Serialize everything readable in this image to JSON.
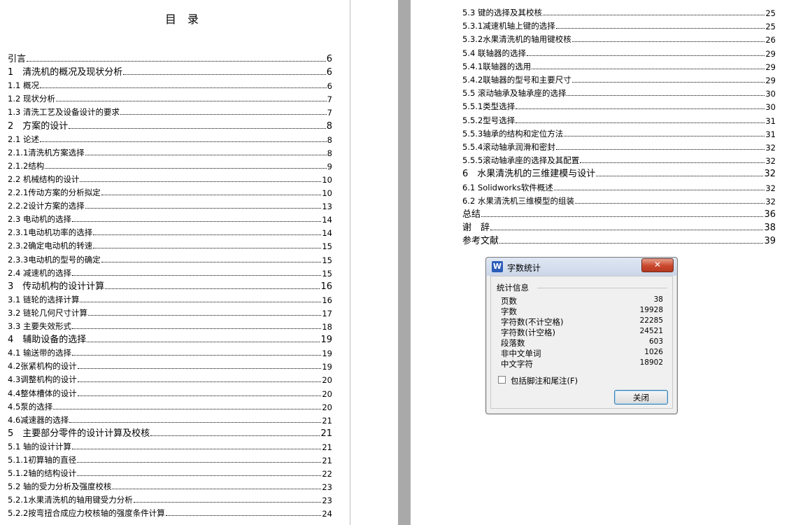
{
  "left_page": {
    "title": "目　录",
    "entries": [
      {
        "text": "引言",
        "page": "6",
        "level": 0
      },
      {
        "text": "1　清洗机的概况及现状分析",
        "page": "6",
        "level": 0
      },
      {
        "text": "1.1 概况",
        "page": "6",
        "level": 1
      },
      {
        "text": "1.2 现状分析",
        "page": "7",
        "level": 1
      },
      {
        "text": "1.3 清洗工艺及设备设计的要求",
        "page": "7",
        "level": 1
      },
      {
        "text": "2　方案的设计",
        "page": "8",
        "level": 0
      },
      {
        "text": "2.1 论述",
        "page": "8",
        "level": 1
      },
      {
        "text": "2.1.1清洗机方案选择",
        "page": "8",
        "level": 1
      },
      {
        "text": "2.1.2结构",
        "page": "9",
        "level": 1
      },
      {
        "text": "2.2 机械结构的设计",
        "page": "10",
        "level": 1
      },
      {
        "text": "2.2.1传动方案的分析拟定",
        "page": "10",
        "level": 1
      },
      {
        "text": "2.2.2设计方案的选择",
        "page": "13",
        "level": 1
      },
      {
        "text": "2.3 电动机的选择",
        "page": "14",
        "level": 1
      },
      {
        "text": "2.3.1电动机功率的选择",
        "page": "14",
        "level": 1
      },
      {
        "text": "2.3.2确定电动机的转速",
        "page": "15",
        "level": 1
      },
      {
        "text": "2.3.3电动机的型号的确定",
        "page": "15",
        "level": 1
      },
      {
        "text": "2.4 减速机的选择",
        "page": "15",
        "level": 1
      },
      {
        "text": "3　传动机构的设计计算",
        "page": "16",
        "level": 0
      },
      {
        "text": "3.1 链轮的选择计算",
        "page": "16",
        "level": 1
      },
      {
        "text": "3.2 链轮几何尺寸计算",
        "page": "17",
        "level": 1
      },
      {
        "text": "3.3 主要失效形式",
        "page": "18",
        "level": 1
      },
      {
        "text": "4　辅助设备的选择",
        "page": "19",
        "level": 0
      },
      {
        "text": "4.1 输送带的选择",
        "page": "19",
        "level": 1
      },
      {
        "text": "4.2张紧机构的设计",
        "page": "19",
        "level": 1
      },
      {
        "text": "4.3调整机构的设计",
        "page": "20",
        "level": 1
      },
      {
        "text": "4.4整体槽体的设计",
        "page": "20",
        "level": 1
      },
      {
        "text": "4.5泵的选择",
        "page": "20",
        "level": 1
      },
      {
        "text": "4.6减速器的选择",
        "page": "21",
        "level": 1
      },
      {
        "text": "5　主要部分零件的设计计算及校核",
        "page": "21",
        "level": 0
      },
      {
        "text": "5.1 轴的设计计算",
        "page": "21",
        "level": 1
      },
      {
        "text": "5.1.1初算轴的直径",
        "page": "21",
        "level": 1
      },
      {
        "text": "5.1.2轴的结构设计",
        "page": "22",
        "level": 1
      },
      {
        "text": "5.2 轴的受力分析及强度校核",
        "page": "23",
        "level": 1
      },
      {
        "text": "5.2.1水果清洗机的轴用键受力分析",
        "page": "23",
        "level": 1
      },
      {
        "text": "5.2.2按弯扭合成应力校核轴的强度条件计算",
        "page": "24",
        "level": 1
      }
    ]
  },
  "right_page": {
    "entries": [
      {
        "text": "5.3 键的选择及其校核",
        "page": "25",
        "level": 1
      },
      {
        "text": "5.3.1减速机轴上键的选择",
        "page": "25",
        "level": 1
      },
      {
        "text": "5.3.2水果清洗机的轴用键校核",
        "page": "26",
        "level": 1
      },
      {
        "text": "5.4 联轴器的选择",
        "page": "29",
        "level": 1
      },
      {
        "text": "5.4.1联轴器的选用",
        "page": "29",
        "level": 1
      },
      {
        "text": "5.4.2联轴器的型号和主要尺寸",
        "page": "29",
        "level": 1
      },
      {
        "text": "5.5 滚动轴承及轴承座的选择",
        "page": "30",
        "level": 1
      },
      {
        "text": "5.5.1类型选择",
        "page": "30",
        "level": 1
      },
      {
        "text": "5.5.2型号选择",
        "page": "31",
        "level": 1
      },
      {
        "text": "5.5.3轴承的结构和定位方法",
        "page": "31",
        "level": 1
      },
      {
        "text": "5.5.4滚动轴承润滑和密封",
        "page": "32",
        "level": 1
      },
      {
        "text": "5.5.5滚动轴承座的选择及其配置",
        "page": "32",
        "level": 1
      },
      {
        "text": "6　水果清洗机的三维建模与设计",
        "page": "32",
        "level": 0
      },
      {
        "text": "6.1 Solidworks软件概述",
        "page": "32",
        "level": 1
      },
      {
        "text": "6.2 水果清洗机三维模型的组装",
        "page": "32",
        "level": 1
      },
      {
        "text": "总结",
        "page": "36",
        "level": 0
      },
      {
        "text": "谢　辞",
        "page": "38",
        "level": 0
      },
      {
        "text": "参考文献",
        "page": "39",
        "level": 0
      }
    ]
  },
  "dialog": {
    "app_icon": "W",
    "title": "字数统计",
    "close_glyph": "✕",
    "group_label": "统计信息",
    "stats": [
      {
        "label": "页数",
        "value": "38"
      },
      {
        "label": "字数",
        "value": "19928"
      },
      {
        "label": "字符数(不计空格)",
        "value": "22285"
      },
      {
        "label": "字符数(计空格)",
        "value": "24521"
      },
      {
        "label": "段落数",
        "value": "603"
      },
      {
        "label": "非中文单词",
        "value": "1026"
      },
      {
        "label": "中文字符",
        "value": "18902"
      }
    ],
    "include_footnotes_label": "包括脚注和尾注(F)",
    "include_footnotes_checked": false,
    "close_button_label": "关闭"
  }
}
